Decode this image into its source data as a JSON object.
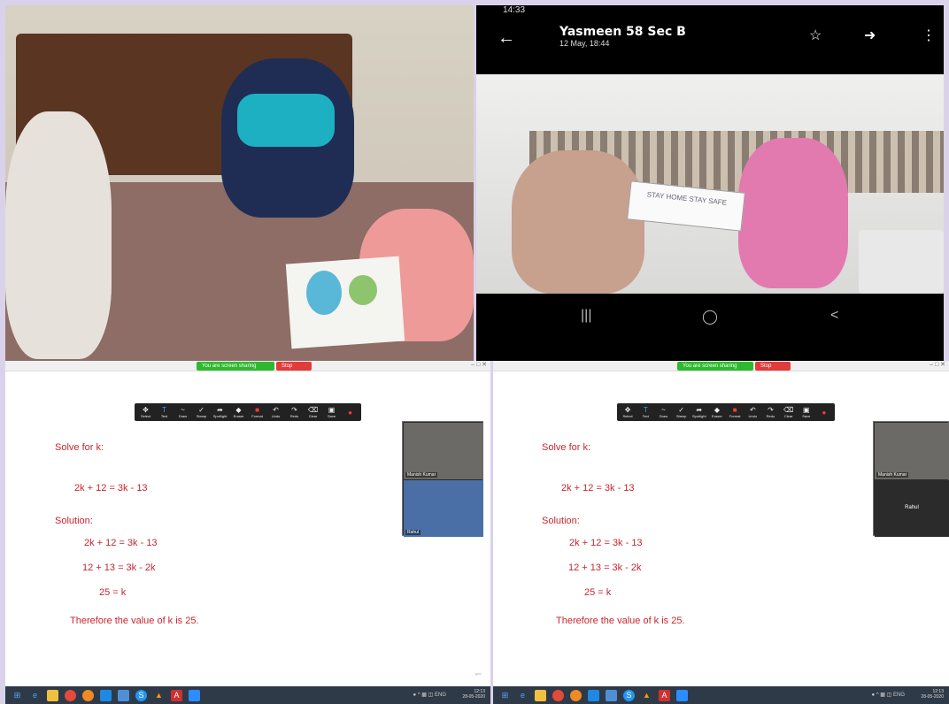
{
  "photo_top_left": {
    "description_icon": "family-drawing-photo"
  },
  "phone_screenshot": {
    "status_time": "14:33",
    "title": "Yasmeen 58 Sec B",
    "subtitle": "12 May, 18:44",
    "sign_text": "STAY HOME STAY SAFE",
    "icons": {
      "back": "arrow-left-icon",
      "star": "star-icon",
      "share": "share-icon",
      "more": "more-vertical-icon"
    }
  },
  "zoom_left": {
    "share_status": "You are screen sharing",
    "stop_share": "Stop Share",
    "toolbar": [
      "Select",
      "Text",
      "Draw",
      "Stamp",
      "Spotlight",
      "Eraser",
      "Format",
      "Undo",
      "Redo",
      "Clear",
      "Save"
    ],
    "problem_title": "Solve for k:",
    "equation": "2k + 12 = 3k - 13",
    "solution_label": "Solution:",
    "steps": [
      "2k + 12 = 3k - 13",
      "12 + 13 = 3k - 2k",
      "25 = k"
    ],
    "conclusion": "Therefore the value of k is 25.",
    "participants": [
      "Manish Kumar",
      "Rahul"
    ],
    "clock": "12:13",
    "date": "28-05-2020",
    "lang": "ENG"
  },
  "zoom_right": {
    "share_status": "You are screen sharing",
    "stop_share": "Stop Share",
    "toolbar": [
      "Select",
      "Text",
      "Draw",
      "Stamp",
      "Spotlight",
      "Eraser",
      "Format",
      "Undo",
      "Redo",
      "Clear",
      "Save"
    ],
    "problem_title": "Solve for k:",
    "equation": "2k + 12 = 3k - 13",
    "solution_label": "Solution:",
    "steps": [
      "2k + 12 = 3k - 13",
      "12 + 13 = 3k - 2k",
      "25 = k"
    ],
    "conclusion": "Therefore the value of k is 25.",
    "participants": [
      "Manish Kumar",
      "Rahul"
    ],
    "clock": "12:13",
    "date": "28-05-2020",
    "lang": "ENG"
  },
  "colors": {
    "math_red": "#c6262e",
    "share_green": "#2fb82f",
    "stop_red": "#e23b3b",
    "taskbar": "#2f3a48"
  }
}
